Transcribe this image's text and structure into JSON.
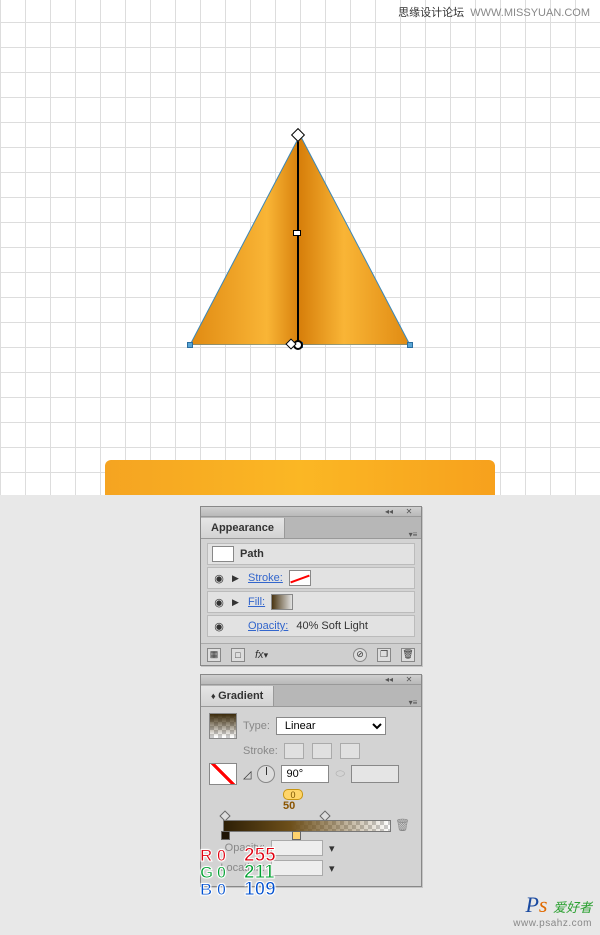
{
  "watermark": {
    "top_left": "思缘设计论坛",
    "top_right": "WWW.MISSYUAN.COM",
    "br_ps": "Ps",
    "br_tag": "爱好者",
    "br_url": "www.psahz.com"
  },
  "artwork": {
    "object": "cone-triangle",
    "gradient_angle_deg": 90,
    "location_stop_label": "0",
    "location_mid_label": "50"
  },
  "appearance_panel": {
    "title": "Appearance",
    "target_name": "Path",
    "rows": {
      "stroke": {
        "label": "Stroke:",
        "value_desc": "none"
      },
      "fill": {
        "label": "Fill:",
        "value_desc": "gradient"
      },
      "opacity": {
        "label": "Opacity:",
        "value": "40% Soft Light"
      }
    },
    "footer_fx": "fx"
  },
  "gradient_panel": {
    "title": "Gradient",
    "type_label": "Type:",
    "type_value": "Linear",
    "stroke_label": "Stroke:",
    "angle_value": "90°",
    "aspect_value": "",
    "opacity_label": "Opacity:",
    "location_label": "Location:",
    "midpoint_marker": {
      "bubble": "0",
      "value": "50"
    },
    "stops": [
      {
        "pos_pct": 0,
        "rgb": {
          "r": 0,
          "g": 0,
          "b": 0
        }
      },
      {
        "pos_pct": 38,
        "rgb": {
          "r": 255,
          "g": 211,
          "b": 109
        }
      }
    ]
  },
  "rgb_readout": {
    "left_column": {
      "R": "0",
      "G": "0",
      "B": "0"
    },
    "highlighted_rgb": {
      "R": "255",
      "G": "211",
      "B": "109"
    }
  }
}
